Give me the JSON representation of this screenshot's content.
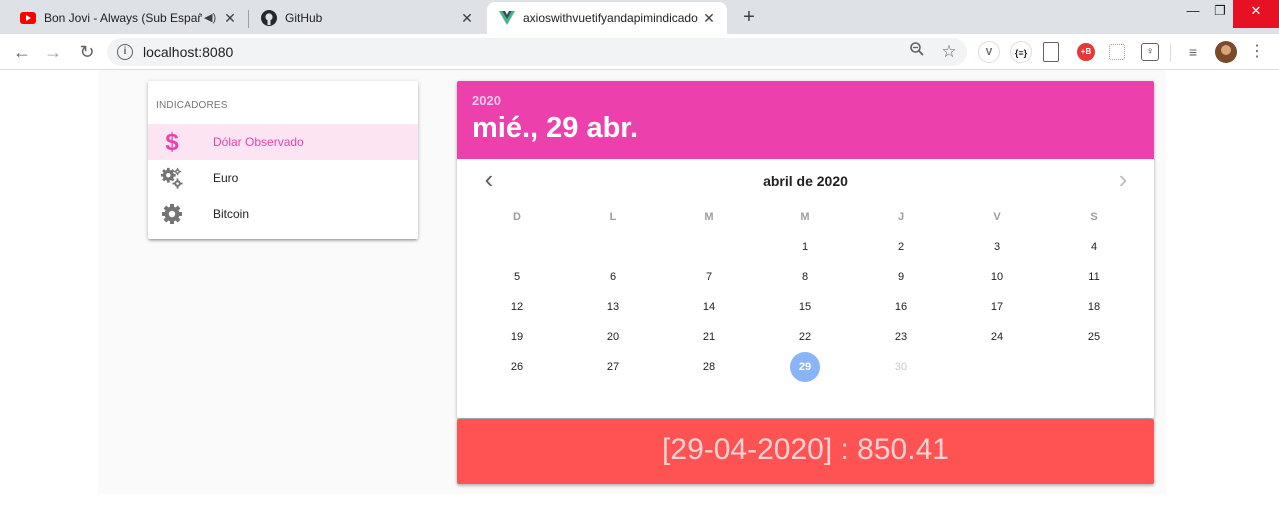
{
  "browser": {
    "tabs": [
      {
        "title": "Bon Jovi - Always (Sub Españ",
        "icon": "youtube-icon",
        "audio": "speaker-icon"
      },
      {
        "title": "GitHub",
        "icon": "github-icon"
      },
      {
        "title": "axioswithvuetifyandapimindicado",
        "icon": "vue-icon",
        "active": true
      }
    ],
    "new_tab": "+",
    "url": "localhost:8080",
    "window": {
      "minimize": "—",
      "maximize": "❐",
      "close": "✕"
    }
  },
  "sidebar": {
    "header": "INDICADORES",
    "items": [
      {
        "label": "Dólar Observado",
        "icon": "dollar-icon",
        "active": true
      },
      {
        "label": "Euro",
        "icon": "gears-icon",
        "active": false
      },
      {
        "label": "Bitcoin",
        "icon": "gear-icon",
        "active": false
      }
    ]
  },
  "datepicker": {
    "year": "2020",
    "date": "mié., 29 abr.",
    "month_label": "abril de 2020",
    "weekdays": [
      "D",
      "L",
      "M",
      "M",
      "J",
      "V",
      "S"
    ],
    "days": [
      "1",
      "2",
      "3",
      "4",
      "5",
      "6",
      "7",
      "8",
      "9",
      "10",
      "11",
      "12",
      "13",
      "14",
      "15",
      "16",
      "17",
      "18",
      "19",
      "20",
      "21",
      "22",
      "23",
      "24",
      "25",
      "26",
      "27",
      "28",
      "29",
      "30"
    ],
    "first_weekday_index": 3,
    "selected_day": "29",
    "disabled_days": [
      "30"
    ],
    "colors": {
      "header": "#ec41ad",
      "selected": "#8ab4f8"
    }
  },
  "result": {
    "text": "[29-04-2020] : 850.41",
    "color": "#ff5252"
  }
}
